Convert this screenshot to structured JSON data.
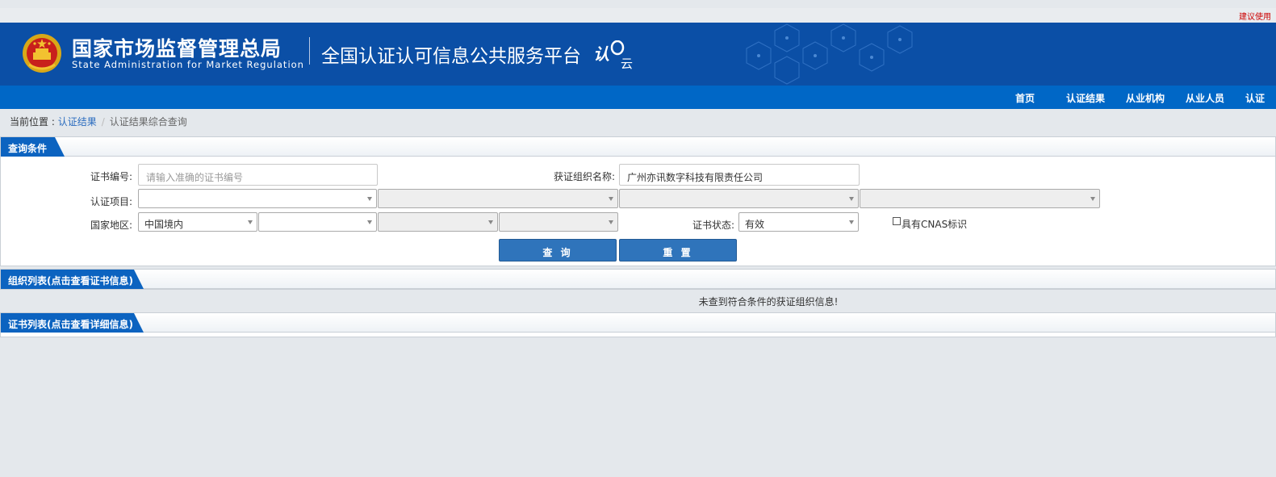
{
  "top_notice": "建议使用",
  "header": {
    "org_cn": "国家市场监督管理总局",
    "org_en": "State Administration  for  Market Regulation",
    "platform": "全国认证认可信息公共服务平台",
    "brand_logo_text": "认云",
    "emblem_icon": "national-emblem-icon"
  },
  "nav": {
    "items": [
      "首页",
      "认证结果",
      "从业机构",
      "从业人员",
      "认证"
    ]
  },
  "breadcrumb": {
    "prefix": "当前位置 : ",
    "link": "认证结果",
    "separator": "/",
    "current": "认证结果综合查询"
  },
  "query_panel": {
    "title": "查询条件",
    "cert_no_label": "证书编号:",
    "cert_no_value": "",
    "cert_no_placeholder": "请输入准确的证书编号",
    "org_name_label": "获证组织名称:",
    "org_name_value": "广州亦讯数字科技有限责任公司",
    "project_label": "认证项目:",
    "project_values": [
      "",
      "",
      "",
      ""
    ],
    "region_label": "国家地区:",
    "region_values": [
      "中国境内",
      "",
      "",
      ""
    ],
    "status_label": "证书状态:",
    "status_value": "有效",
    "cnas_label": "具有CNAS标识",
    "cnas_checked": false,
    "search_button": "查 询",
    "reset_button": "重 置"
  },
  "org_list": {
    "title": "组织列表(点击查看证书信息)",
    "empty_message": "未查到符合条件的获证组织信息!"
  },
  "cert_list": {
    "title": "证书列表(点击查看详细信息)"
  },
  "colors": {
    "banner": "#0b4fa6",
    "navbar": "#0067c6",
    "tab": "#0c63c0",
    "button": "#2f74bb",
    "notice": "#cc0000"
  }
}
